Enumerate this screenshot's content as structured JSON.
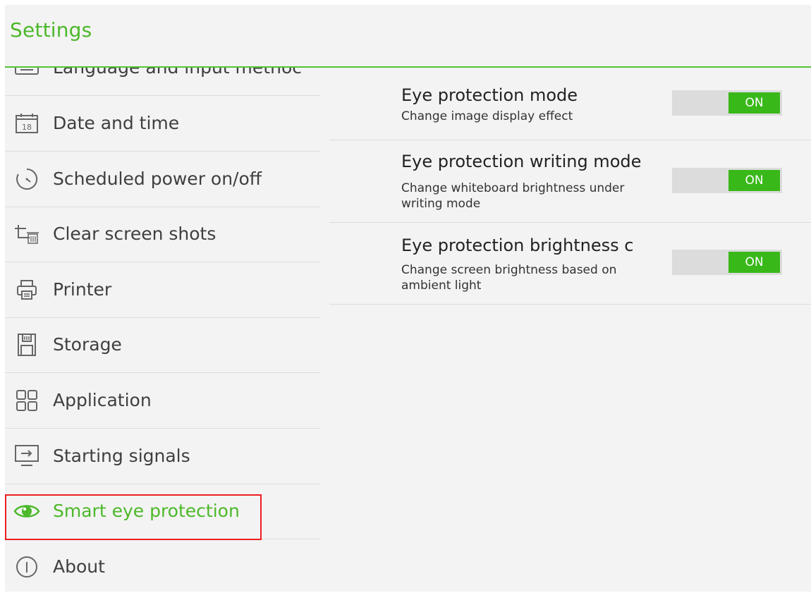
{
  "header": {
    "title": "Settings"
  },
  "sidebar": {
    "items": [
      {
        "label": "Language and input methoc",
        "icon": "keyboard-icon"
      },
      {
        "label": "Date and time",
        "icon": "calendar-icon",
        "icon_text": "18"
      },
      {
        "label": "Scheduled power on/off",
        "icon": "timer-icon"
      },
      {
        "label": "Clear screen shots",
        "icon": "crop-trash-icon"
      },
      {
        "label": "Printer",
        "icon": "printer-icon"
      },
      {
        "label": "Storage",
        "icon": "sd-card-icon"
      },
      {
        "label": "Application",
        "icon": "apps-grid-icon"
      },
      {
        "label": "Starting signals",
        "icon": "input-source-icon"
      },
      {
        "label": "Smart eye protection",
        "icon": "eye-icon",
        "active": true
      },
      {
        "label": "About",
        "icon": "info-icon"
      }
    ]
  },
  "settings": [
    {
      "title": "Eye protection mode",
      "description": "Change image display effect",
      "toggle": "ON"
    },
    {
      "title": "Eye protection writing mode",
      "description": "Change whiteboard brightness under writing mode",
      "toggle": "ON"
    },
    {
      "title": "Eye protection brightness c",
      "description": "Change screen brightness based on ambient light",
      "toggle": "ON"
    }
  ],
  "colors": {
    "accent": "#4cb82a",
    "toggle_on": "#39b81a",
    "highlight": "#ee1f1f",
    "background": "#f3f3f3"
  }
}
